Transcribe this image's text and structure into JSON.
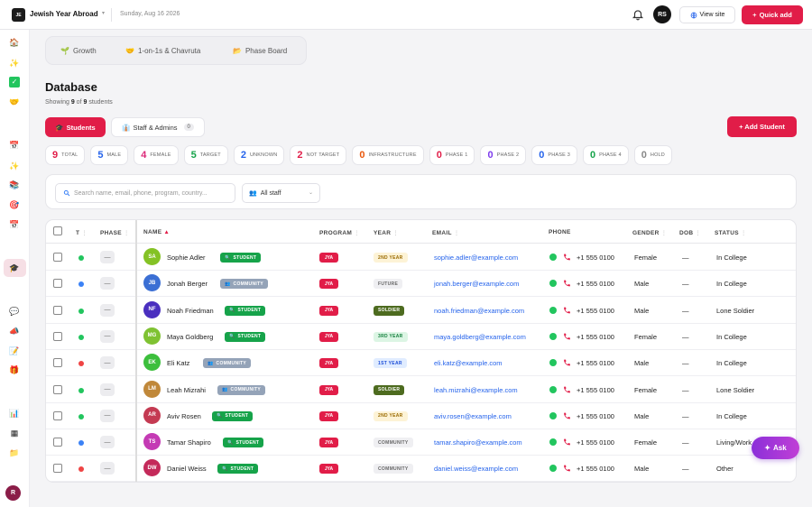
{
  "header": {
    "logo_text": "JE",
    "app_title": "Jewish Year Abroad",
    "date": "Sunday, Aug 16 2026",
    "user_initials": "RS",
    "view_site_label": "View site",
    "quick_add_label": "Quick add"
  },
  "sidebar": {
    "user_initial": "R",
    "icons": [
      "home-icon",
      "sparkle-icon",
      "check-icon",
      "handshake-icon",
      "calendar-icon",
      "sparkle-icon",
      "books-icon",
      "target-icon",
      "calendar-icon",
      "graduation-cap-icon",
      "chat-icon",
      "megaphone-icon",
      "document-icon",
      "gift-icon",
      "bar-chart-icon",
      "grid-icon",
      "folder-icon"
    ]
  },
  "nav_tabs": [
    {
      "label": "Growth",
      "icon": "seedling-icon"
    },
    {
      "label": "1-on-1s & Chavruta",
      "icon": "handshake-icon"
    },
    {
      "label": "Phase Board",
      "icon": "folder-icon"
    }
  ],
  "page": {
    "title": "Database",
    "showing_prefix": "Showing",
    "showing_count": "9",
    "showing_of": "of",
    "showing_total": "9",
    "showing_suffix": "students"
  },
  "tabs": {
    "students_label": "Students",
    "staff_label": "Staff & Admins",
    "staff_count": "0"
  },
  "add_student_label": "+ Add Student",
  "chips": [
    {
      "n": "9",
      "label": "TOTAL",
      "color": "#e11d48"
    },
    {
      "n": "5",
      "label": "MALE",
      "color": "#2563eb"
    },
    {
      "n": "4",
      "label": "FEMALE",
      "color": "#db2777"
    },
    {
      "n": "5",
      "label": "TARGET",
      "color": "#16a34a"
    },
    {
      "n": "2",
      "label": "UNKNOWN",
      "color": "#2563eb"
    },
    {
      "n": "2",
      "label": "NOT TARGET",
      "color": "#e11d48"
    },
    {
      "n": "0",
      "label": "INFRASTRUCTURE",
      "color": "#ea580c"
    },
    {
      "n": "0",
      "label": "PHASE 1",
      "color": "#e11d48"
    },
    {
      "n": "0",
      "label": "PHASE 2",
      "color": "#7c3aed"
    },
    {
      "n": "0",
      "label": "PHASE 3",
      "color": "#2563eb"
    },
    {
      "n": "0",
      "label": "PHASE 4",
      "color": "#16a34a"
    },
    {
      "n": "0",
      "label": "HOLD",
      "color": "#888888"
    }
  ],
  "filters": {
    "search_placeholder": "Search name, email, phone, program, country...",
    "staff_value": "All staff"
  },
  "table": {
    "headers": {
      "t": "T",
      "phase": "PHASE",
      "name": "NAME",
      "program": "PROGRAM",
      "year": "YEAR",
      "email": "EMAIL",
      "phone": "PHONE",
      "gender": "GENDER",
      "dob": "DOB",
      "status": "STATUS"
    },
    "rows": [
      {
        "dot": "#22c55e",
        "phase": "—",
        "initials": "SA",
        "avatar": "#84c225",
        "name": "Sophie Adler",
        "role": "STUDENT",
        "program": "JYA",
        "year": "2ND YEAR",
        "email": "sophie.adler@example.com",
        "phone": "+1 555 0100",
        "gender": "Female",
        "dob": "—",
        "status": "In College"
      },
      {
        "dot": "#3b82f6",
        "phase": "—",
        "initials": "JB",
        "avatar": "#3b6fd4",
        "name": "Jonah Berger",
        "role": "COMMUNITY",
        "program": "JYA",
        "year": "FUTURE",
        "email": "jonah.berger@example.com",
        "phone": "+1 555 0100",
        "gender": "Male",
        "dob": "—",
        "status": "In College"
      },
      {
        "dot": "#22c55e",
        "phase": "—",
        "initials": "NF",
        "avatar": "#4a2fbf",
        "name": "Noah Friedman",
        "role": "STUDENT",
        "program": "JYA",
        "year": "SOLDIER",
        "email": "noah.friedman@example.com",
        "phone": "+1 555 0100",
        "gender": "Male",
        "dob": "—",
        "status": "Lone Soldier"
      },
      {
        "dot": "#22c55e",
        "phase": "—",
        "initials": "MG",
        "avatar": "#7fc232",
        "name": "Maya Goldberg",
        "role": "STUDENT",
        "program": "JYA",
        "year": "3RD YEAR",
        "email": "maya.goldberg@example.com",
        "phone": "+1 555 0100",
        "gender": "Female",
        "dob": "—",
        "status": "In College"
      },
      {
        "dot": "#ef4444",
        "phase": "—",
        "initials": "EK",
        "avatar": "#3cbf3c",
        "name": "Eli Katz",
        "role": "COMMUNITY",
        "program": "JYA",
        "year": "1ST YEAR",
        "email": "eli.katz@example.com",
        "phone": "+1 555 0100",
        "gender": "Male",
        "dob": "—",
        "status": "In College"
      },
      {
        "dot": "#22c55e",
        "phase": "—",
        "initials": "LM",
        "avatar": "#c0883a",
        "name": "Leah Mizrahi",
        "role": "COMMUNITY",
        "program": "JYA",
        "year": "SOLDIER",
        "email": "leah.mizrahi@example.com",
        "phone": "+1 555 0100",
        "gender": "Female",
        "dob": "—",
        "status": "Lone Soldier"
      },
      {
        "dot": "#22c55e",
        "phase": "—",
        "initials": "AR",
        "avatar": "#c43a52",
        "name": "Aviv Rosen",
        "role": "STUDENT",
        "program": "JYA",
        "year": "2ND YEAR",
        "email": "aviv.rosen@example.com",
        "phone": "+1 555 0100",
        "gender": "Male",
        "dob": "—",
        "status": "In College"
      },
      {
        "dot": "#3b82f6",
        "phase": "—",
        "initials": "TS",
        "avatar": "#c43ab4",
        "name": "Tamar Shapiro",
        "role": "STUDENT",
        "program": "JYA",
        "year": "COMMUNITY",
        "email": "tamar.shapiro@example.com",
        "phone": "+1 555 0100",
        "gender": "Female",
        "dob": "—",
        "status": "Living/Work"
      },
      {
        "dot": "#ef4444",
        "phase": "—",
        "initials": "DW",
        "avatar": "#c42a5a",
        "name": "Daniel Weiss",
        "role": "STUDENT",
        "program": "JYA",
        "year": "COMMUNITY",
        "email": "daniel.weiss@example.com",
        "phone": "+1 555 0100",
        "gender": "Male",
        "dob": "—",
        "status": "Other"
      }
    ]
  },
  "ask_label": "Ask",
  "colors": {
    "accent": "#e11d48",
    "student": "#16a34a",
    "community": "#94a3b8"
  }
}
